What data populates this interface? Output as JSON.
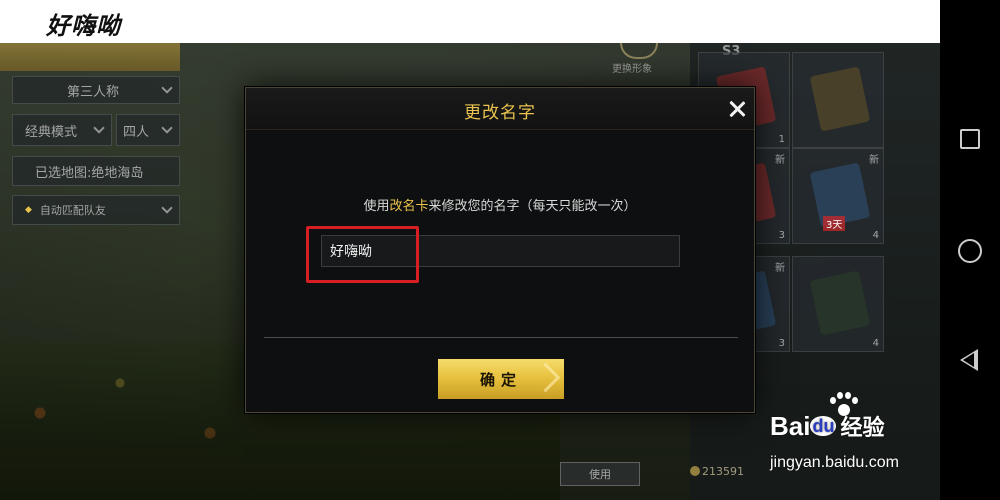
{
  "top_strip": {
    "handwritten_name": "好嗨呦"
  },
  "game": {
    "perspective": "第三人称",
    "mode": "经典模式",
    "squad": "四人",
    "map": "已选地图:绝地海岛",
    "auto_match": "自动匹配队友",
    "change_look": "更换形象",
    "season_label": "S3",
    "use_button": "使用",
    "coins": "213591",
    "inventory": [
      {
        "badge": "",
        "count": "1",
        "color": "#8a2a2a"
      },
      {
        "badge": "",
        "count": "",
        "color": "#5a4a2a"
      },
      {
        "badge": "新",
        "count": "3",
        "color": "#8a2a2a"
      },
      {
        "badge": "新",
        "count": "4",
        "color": "#2e4a6a",
        "tag": "3天"
      },
      {
        "badge": "新",
        "count": "3",
        "color": "#2a4a6a"
      },
      {
        "badge": "",
        "count": "4",
        "color": "#2a3a2a"
      }
    ]
  },
  "dialog": {
    "title": "更改名字",
    "instruction_prefix": "使用",
    "instruction_highlight": "改名卡",
    "instruction_suffix": "来修改您的名字（每天只能改一次）",
    "name_value": "好嗨呦",
    "confirm_label": "确定",
    "accent_color": "#e9c34d",
    "highlight_color": "#d61e24"
  },
  "watermark": {
    "brand_prefix": "Bai",
    "brand_du": "du",
    "brand_suffix": "经验",
    "url": "jingyan.baidu.com"
  },
  "android_nav": [
    "recent-apps",
    "home",
    "back"
  ]
}
